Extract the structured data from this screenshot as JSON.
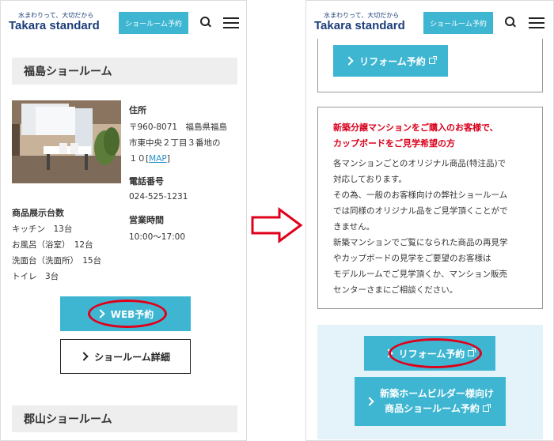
{
  "header": {
    "tagline": "水まわりって、大切だから",
    "logo": "Takara standard",
    "showroom_button": "ショールーム予約"
  },
  "left": {
    "section_title": "福島ショールーム",
    "address_label": "住所",
    "address_lines": [
      "〒960-8071　福島県福島",
      "市東中央２丁目３番地の",
      "１０"
    ],
    "map_link": "MAP",
    "phone_label": "電話番号",
    "phone": "024-525-1231",
    "hours_label": "営業時間",
    "hours": "10:00〜17:00",
    "display_label": "商品展示台数",
    "display_items": [
      "キッチン　13台",
      "お風呂（浴室）　12台",
      "洗面台（洗面所）　15台",
      "トイレ　3台"
    ],
    "web_reserve_button": "WEB予約",
    "detail_button": "ショールーム詳細",
    "next_section_title": "郡山ショールーム"
  },
  "right": {
    "reform_button_top": "リフォーム予約",
    "notice_title_lines": [
      "新築分譲マンションをご購入のお客様で、",
      "カップボードをご見学希望の方"
    ],
    "notice_body_lines": [
      "各マンションごとのオリジナル商品(特注品)で",
      "対応しております。",
      "その為、一般のお客様向けの弊社ショールーム",
      "では同様のオリジナル品をご見学頂くことがで",
      "きません。",
      "新築マンションでご覧になられた商品の再見学",
      "やカップボードの見学をご要望のお客様は",
      "モデルルームでご見学頂くか、マンション販売",
      "センターさまにご相談ください。"
    ],
    "reform_button": "リフォーム予約",
    "builder_button_lines": [
      "新築ホームビルダー様向け",
      "商品ショールーム予約"
    ]
  },
  "colors": {
    "accent": "#3eb6d2",
    "highlight": "#e0001b",
    "brand": "#1c3d7a"
  }
}
